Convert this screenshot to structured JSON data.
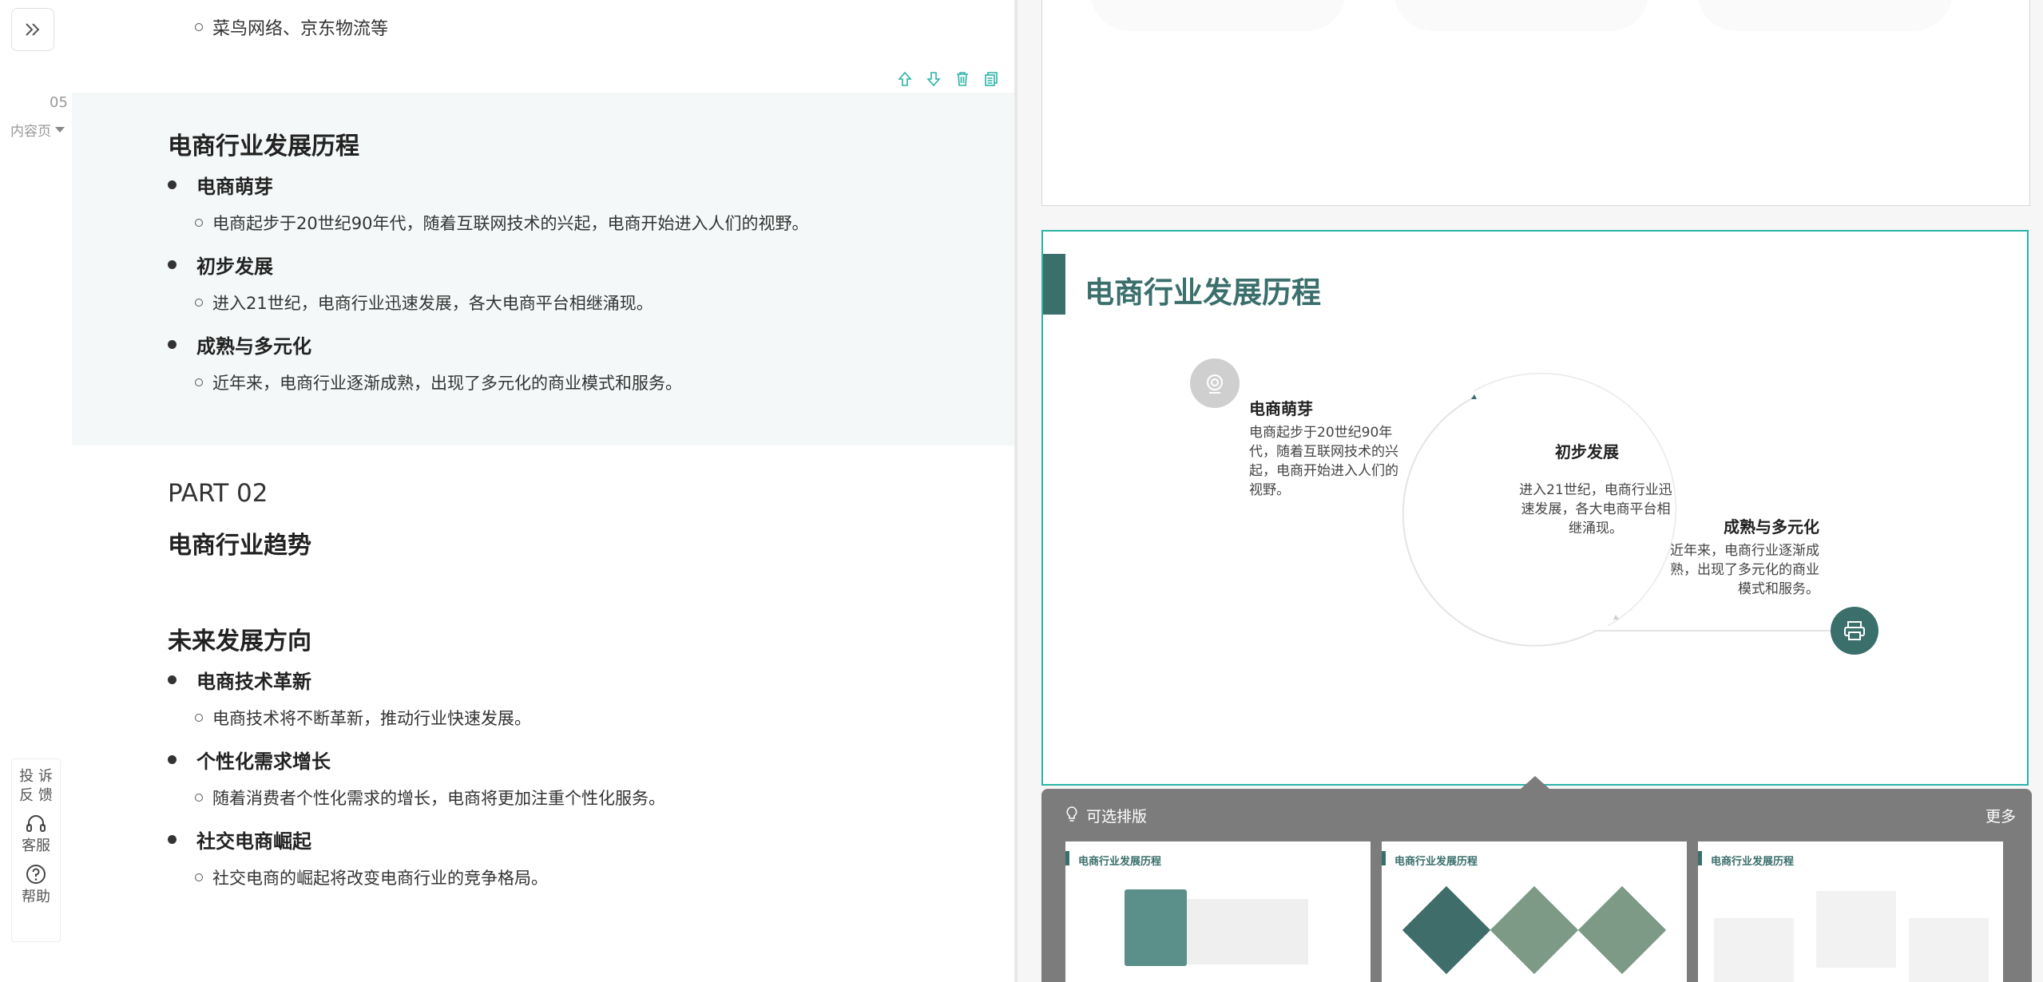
{
  "outline": {
    "prev_sub": "菜鸟网络、京东物流等",
    "slide_num": "05",
    "slide_type": "内容页",
    "section": {
      "title": "电商行业发展历程",
      "items": [
        {
          "heading": "电商萌芽",
          "detail": "电商起步于20世纪90年代，随着互联网技术的兴起，电商开始进入人们的视野。"
        },
        {
          "heading": "初步发展",
          "detail": "进入21世纪，电商行业迅速发展，各大电商平台相继涌现。"
        },
        {
          "heading": "成熟与多元化",
          "detail": "近年来，电商行业逐渐成熟，出现了多元化的商业模式和服务。"
        }
      ]
    },
    "part_label": "PART 02",
    "part_title": "电商行业趋势",
    "section2": {
      "title": "未来发展方向",
      "items": [
        {
          "heading": "电商技术革新",
          "detail": "电商技术将不断革新，推动行业快速发展。"
        },
        {
          "heading": "个性化需求增长",
          "detail": "随着消费者个性化需求的增长，电商将更加注重个性化服务。"
        },
        {
          "heading": "社交电商崛起",
          "detail": "社交电商的崛起将改变电商行业的竞争格局。"
        }
      ]
    }
  },
  "side_tools": {
    "feedback": "投 诉\n反 馈",
    "service": "客服",
    "help": "帮助"
  },
  "preview": {
    "title": "电商行业发展历程",
    "item1_head": "电商萌芽",
    "item1_body": "电商起步于20世纪90年代，随着互联网技术的兴起，电商开始进入人们的视野。",
    "item2_head": "初步发展",
    "item2_body": "进入21世纪，电商行业迅速发展，各大电商平台相继涌现。",
    "item3_head": "成熟与多元化",
    "item3_body": "近年来，电商行业逐渐成熟，出现了多元化的商业模式和服务。",
    "accent_color": "#3a6f6c",
    "selection_color": "#2ab4a7"
  },
  "picker": {
    "title": "可选排版",
    "more": "更多",
    "thumbs": [
      {
        "title": "电商行业发展历程"
      },
      {
        "title": "电商行业发展历程"
      },
      {
        "title": "电商行业发展历程"
      }
    ]
  },
  "icons": [
    "expand-icon",
    "move-up-icon",
    "move-down-icon",
    "delete-icon",
    "copy-icon",
    "headset-icon",
    "help-icon",
    "lightbulb-icon",
    "webcam-icon",
    "printer-icon"
  ]
}
